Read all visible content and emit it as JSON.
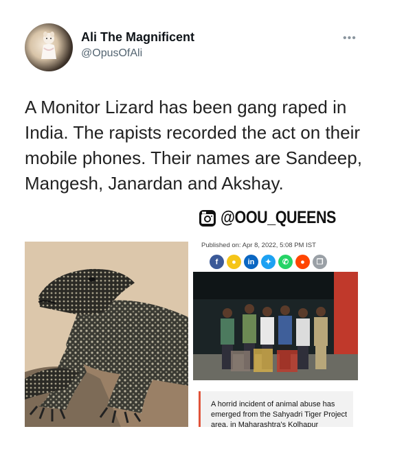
{
  "tweet": {
    "author_name": "Ali The Magnificent",
    "author_handle": "@OpusOfAli",
    "more_label": "•••",
    "text": "A Monitor Lizard has been gang raped in India. The rapists recorded the act on their mobile phones. Their names are Sandeep, Mangesh, Janardan and Akshay."
  },
  "watermark": {
    "icon": "instagram-icon",
    "text": "@OOU_QUEENS"
  },
  "article": {
    "published": "Published on: Apr 8, 2022, 5:08 PM IST",
    "share_buttons": [
      {
        "icon": "facebook-icon",
        "glyph": "f",
        "color": "#3b5998"
      },
      {
        "icon": "koo-icon",
        "glyph": "●",
        "color": "#f5c518"
      },
      {
        "icon": "linkedin-icon",
        "glyph": "in",
        "color": "#0a66c2"
      },
      {
        "icon": "twitter-icon",
        "glyph": "✦",
        "color": "#1da1f2"
      },
      {
        "icon": "whatsapp-icon",
        "glyph": "✆",
        "color": "#25d366"
      },
      {
        "icon": "reddit-icon",
        "glyph": "●",
        "color": "#ff4500"
      },
      {
        "icon": "copy-icon",
        "glyph": "❐",
        "color": "#9aa0a6"
      }
    ],
    "caption": "A horrid incident of animal abuse has emerged from the Sahyadri Tiger Project area, in Maharashtra's Kolhapur"
  }
}
